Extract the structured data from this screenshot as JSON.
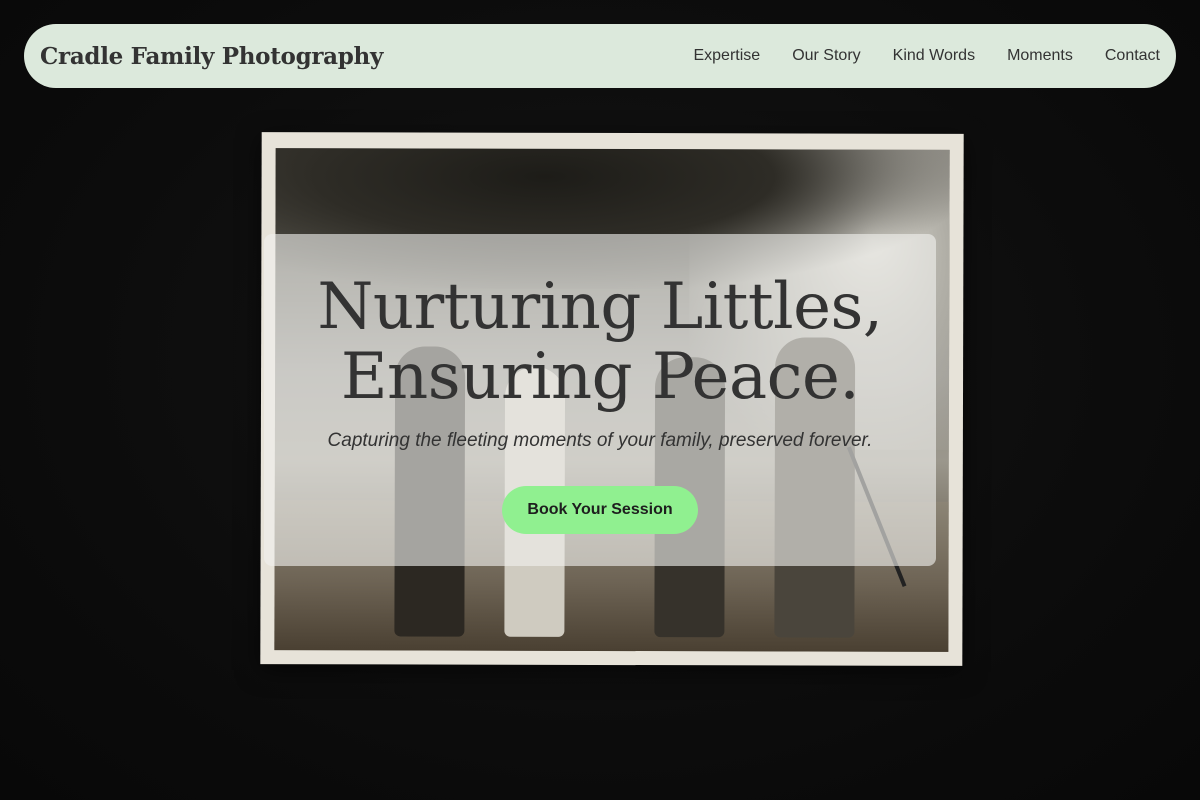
{
  "brand": {
    "name": "Cradle Family Photography"
  },
  "nav": {
    "items": [
      {
        "label": "Expertise"
      },
      {
        "label": "Our Story"
      },
      {
        "label": "Kind Words"
      },
      {
        "label": "Moments"
      },
      {
        "label": "Contact"
      }
    ]
  },
  "hero": {
    "title_line1": "Nurturing Littles,",
    "title_line2": "Ensuring Peace.",
    "subtitle": "Capturing the fleeting moments of your family, preserved forever.",
    "cta_label": "Book Your Session"
  },
  "colors": {
    "background": "#0d0d0d",
    "nav_background": "#dce9dc",
    "text": "#333333",
    "cta": "#90f090"
  }
}
